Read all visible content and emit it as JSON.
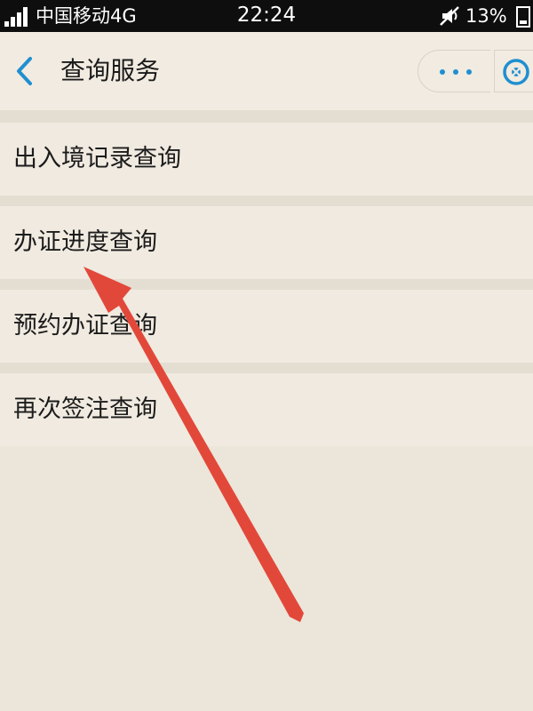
{
  "status_bar": {
    "carrier": "中国移动4G",
    "time": "22:24",
    "battery": "13%",
    "icons": [
      "signal-icon",
      "mute-icon",
      "battery-icon"
    ]
  },
  "nav": {
    "title": "查询服务",
    "back_icon": "chevron-left-icon",
    "more_icon": "more-dots-icon",
    "close_icon": "close-circle-icon",
    "accent_color": "#1f8fd0"
  },
  "menu": {
    "items": [
      {
        "label": "出入境记录查询"
      },
      {
        "label": "办证进度查询"
      },
      {
        "label": "预约办证查询"
      },
      {
        "label": "再次签注查询"
      }
    ]
  },
  "annotation": {
    "icon": "red-arrow-icon",
    "color": "#e2483a",
    "points_to": "办证进度查询"
  }
}
